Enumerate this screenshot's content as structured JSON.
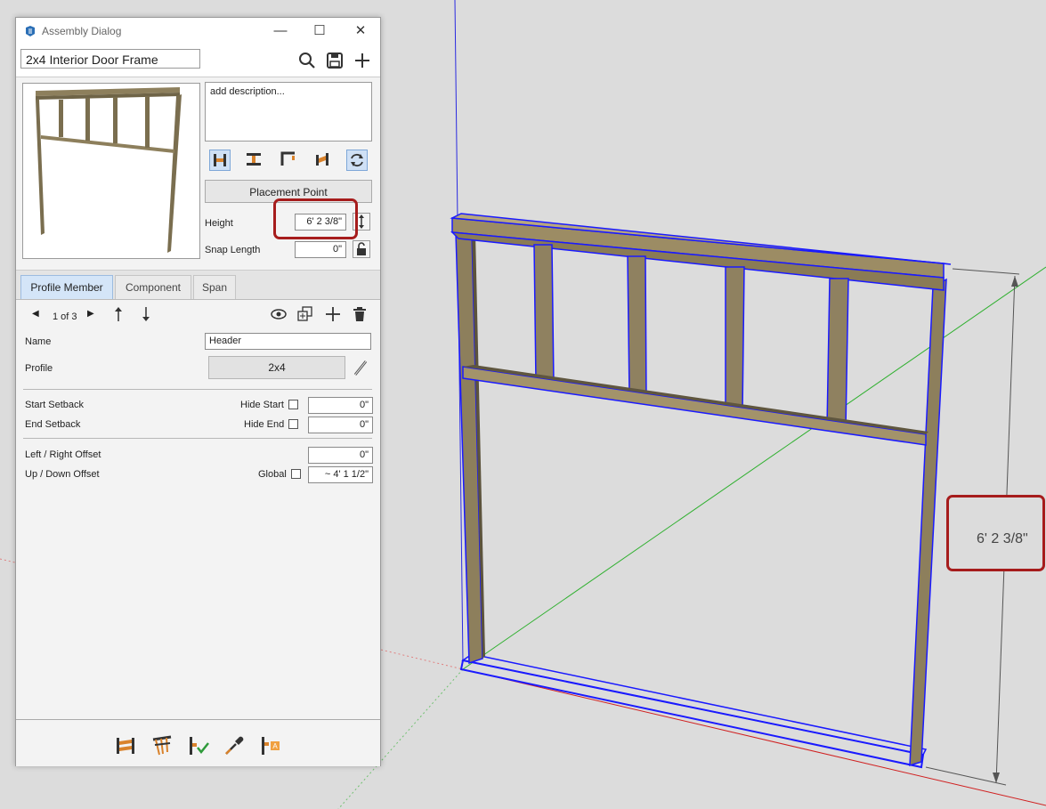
{
  "window": {
    "title": "Assembly Dialog",
    "minimize": "—",
    "maximize": "☐",
    "close": "✕"
  },
  "assembly": {
    "name": "2x4 Interior Door Frame",
    "description": "add description...",
    "placement_point_label": "Placement Point",
    "height_label": "Height",
    "height_value": "6' 2 3/8\"",
    "snap_length_label": "Snap Length",
    "snap_length_value": "0\""
  },
  "tabs": [
    {
      "label": "Profile Member",
      "active": true
    },
    {
      "label": "Component",
      "active": false
    },
    {
      "label": "Span",
      "active": false
    }
  ],
  "member": {
    "pager": "1 of 3",
    "name_label": "Name",
    "name_value": "Header",
    "profile_label": "Profile",
    "profile_value": "2x4",
    "start_setback_label": "Start Setback",
    "hide_start_label": "Hide Start",
    "start_setback_value": "0\"",
    "end_setback_label": "End Setback",
    "hide_end_label": "Hide End",
    "end_setback_value": "0\"",
    "lr_offset_label": "Left / Right Offset",
    "lr_offset_value": "0\"",
    "ud_offset_label": "Up / Down Offset",
    "global_label": "Global",
    "ud_offset_value": "~ 4' 1 1/2\""
  },
  "viewport": {
    "dimension_label": "6' 2 3/8\""
  },
  "colors": {
    "highlight": "#a61c1c",
    "selection": "#1a1aff",
    "wood": "#8b7d5a",
    "active_tab": "#d4e5f8"
  }
}
